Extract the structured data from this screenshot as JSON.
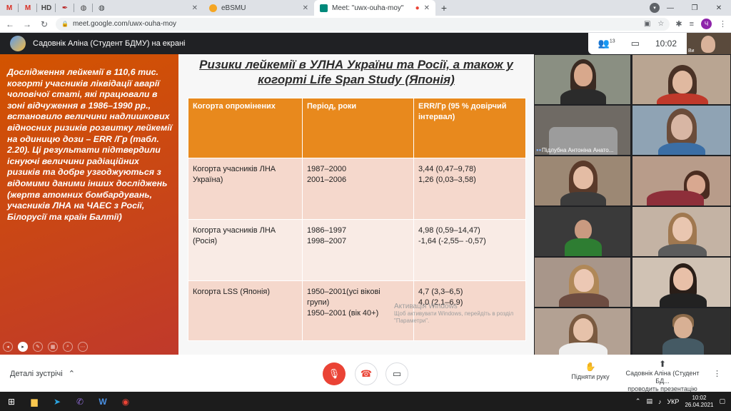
{
  "browser": {
    "mini_tabs": [
      "M",
      "M",
      "HD"
    ],
    "tab_ebsmu": "eBSMU",
    "tab_meet": "Meet: \"uwx-ouha-moy\"",
    "url": "meet.google.com/uwx-ouha-moy",
    "profile_initial": "Ч"
  },
  "meet": {
    "presenter_title": "Садовнік Аліна (Студент БДМУ) на екрані",
    "participant_count": "13",
    "time": "10:02",
    "self_label": "Ви"
  },
  "slide": {
    "left_text": "Дослідження лейкемії в 110,6 тис. когорті учасників ліквідації аварії чоловічої статі, які працювали в зоні відчуження в 1986–1990 рр., встановило величини надлишкових відносних ризиків розвитку лейкемії на одиницю дози – ERR /Гр (табл. 2.20). Ці результати підтвердили існуючі величини радіаційних ризиків та добре узгоджуються з відомими даними інших досліджень (жертв атомних бомбардувань, учасників ЛНА на ЧАЕС з Росії, Білорусії та країн Балтії)",
    "title": "Ризики лейкемії в УЛНА України та Росії, а також у когорті Life Span Study (Японія)",
    "table": {
      "headers": [
        "Когорта опромінених",
        "Період, роки",
        "ERR/Гр (95 % довірчий інтервал)"
      ],
      "rows": [
        {
          "cohort": "Когорта учасників ЛНА Україна)",
          "periods": [
            "1987–2000",
            "2001–2006"
          ],
          "err": [
            "3,44 (0,47–9,78)",
            "1,26 (0,03–3,58)"
          ]
        },
        {
          "cohort": "Когорта учасників ЛНА (Росія)",
          "periods": [
            "1986–1997",
            "1998–2007"
          ],
          "err": [
            "4,98 (0,59–14,47)",
            "-1,64 (-2,55– -0,57)"
          ]
        },
        {
          "cohort": "Когорта LSS (Японія)",
          "periods": [
            "1950–2001(усі вікові",
            "групи)",
            "1950–2001 (вік 40+)"
          ],
          "err": [
            "4,7 (3,3–6,5)",
            "4,0 (2,1–6,9)"
          ]
        }
      ]
    },
    "watermark_title": "Активація Windows",
    "watermark_text": "Щоб активувати Windows, перейдіть в розділ \"Параметри\"."
  },
  "participants": {
    "named_tile": "Підлубна Антоніна Анато..."
  },
  "bottom": {
    "meeting_details": "Деталі зустрічі",
    "raise_hand": "Підняти руку",
    "presenting_name": "Садовнік Аліна (Студент БД...",
    "presenting_status": "проводить презентацію"
  },
  "taskbar": {
    "lang": "УКР",
    "time": "10:02",
    "date": "26.04.2021"
  },
  "colors": {
    "slide_orange": "#e8891d",
    "slide_left": "#d35400",
    "end_call_red": "#ea4335",
    "meet_bg": "#202124"
  }
}
